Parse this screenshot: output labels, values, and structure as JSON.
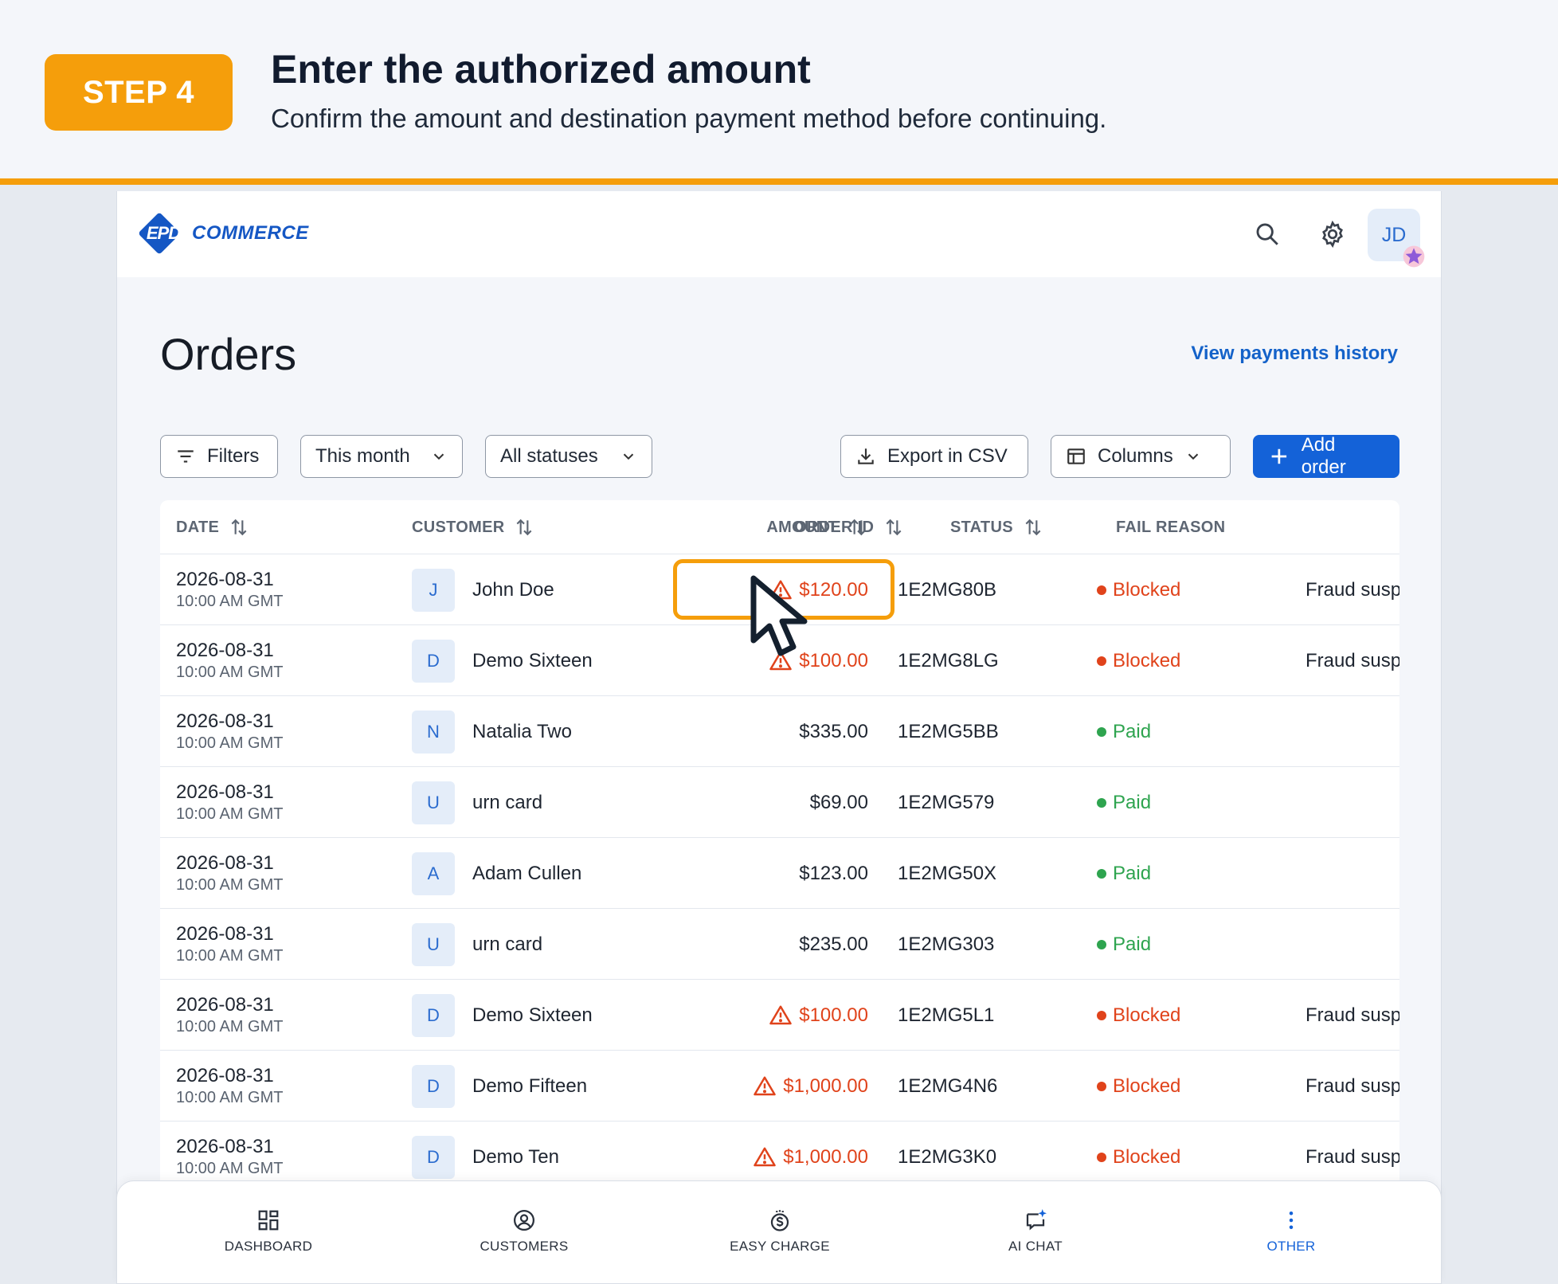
{
  "step": {
    "badge": "STEP 4",
    "title": "Enter the authorized amount",
    "subtitle": "Confirm the amount and destination payment method before continuing."
  },
  "brand": {
    "logo_mark": "EPD",
    "logo_word": "COMMERCE"
  },
  "header": {
    "avatar_initials": "JD",
    "icons": [
      "search-icon",
      "gear-icon"
    ]
  },
  "page": {
    "title": "Orders",
    "history_link": "View payments history"
  },
  "toolbar": {
    "filters": "Filters",
    "period": "This month",
    "status": "All statuses",
    "export": "Export in CSV",
    "columns": "Columns",
    "add": "Add order"
  },
  "table": {
    "columns": [
      "DATE",
      "CUSTOMER",
      "AMOUNT",
      "ORDER ID",
      "STATUS",
      "FAIL REASON"
    ],
    "rows": [
      {
        "date": "2026-08-31",
        "time": "10:00 AM GMT",
        "initial": "J",
        "customer": "John Doe",
        "amount": "$120.00",
        "warn": true,
        "order_id": "1E2MG80B",
        "status": "Blocked",
        "fail": "Fraud susp"
      },
      {
        "date": "2026-08-31",
        "time": "10:00 AM GMT",
        "initial": "D",
        "customer": "Demo Sixteen",
        "amount": "$100.00",
        "warn": true,
        "order_id": "1E2MG8LG",
        "status": "Blocked",
        "fail": "Fraud susp"
      },
      {
        "date": "2026-08-31",
        "time": "10:00 AM GMT",
        "initial": "N",
        "customer": "Natalia Two",
        "amount": "$335.00",
        "warn": false,
        "order_id": "1E2MG5BB",
        "status": "Paid",
        "fail": ""
      },
      {
        "date": "2026-08-31",
        "time": "10:00 AM GMT",
        "initial": "U",
        "customer": "urn card",
        "amount": "$69.00",
        "warn": false,
        "order_id": "1E2MG579",
        "status": "Paid",
        "fail": ""
      },
      {
        "date": "2026-08-31",
        "time": "10:00 AM GMT",
        "initial": "A",
        "customer": "Adam Cullen",
        "amount": "$123.00",
        "warn": false,
        "order_id": "1E2MG50X",
        "status": "Paid",
        "fail": ""
      },
      {
        "date": "2026-08-31",
        "time": "10:00 AM GMT",
        "initial": "U",
        "customer": "urn card",
        "amount": "$235.00",
        "warn": false,
        "order_id": "1E2MG303",
        "status": "Paid",
        "fail": ""
      },
      {
        "date": "2026-08-31",
        "time": "10:00 AM GMT",
        "initial": "D",
        "customer": "Demo Sixteen",
        "amount": "$100.00",
        "warn": true,
        "order_id": "1E2MG5L1",
        "status": "Blocked",
        "fail": "Fraud susp"
      },
      {
        "date": "2026-08-31",
        "time": "10:00 AM GMT",
        "initial": "D",
        "customer": "Demo Fifteen",
        "amount": "$1,000.00",
        "warn": true,
        "order_id": "1E2MG4N6",
        "status": "Blocked",
        "fail": "Fraud susp"
      },
      {
        "date": "2026-08-31",
        "time": "10:00 AM GMT",
        "initial": "D",
        "customer": "Demo Ten",
        "amount": "$1,000.00",
        "warn": true,
        "order_id": "1E2MG3K0",
        "status": "Blocked",
        "fail": "Fraud susp"
      }
    ]
  },
  "nav": [
    {
      "label": "DASHBOARD",
      "icon": "grid-icon",
      "active": false
    },
    {
      "label": "CUSTOMERS",
      "icon": "user-circle-icon",
      "active": false
    },
    {
      "label": "EASY CHARGE",
      "icon": "dollar-coin-icon",
      "active": false
    },
    {
      "label": "AI CHAT",
      "icon": "chat-sparkle-icon",
      "active": false
    },
    {
      "label": "OTHER",
      "icon": "more-vertical-icon",
      "active": true
    }
  ],
  "colors": {
    "accent": "#f59e0b",
    "primary": "#1462d8",
    "blocked": "#e0431b",
    "paid": "#2ea44f"
  }
}
